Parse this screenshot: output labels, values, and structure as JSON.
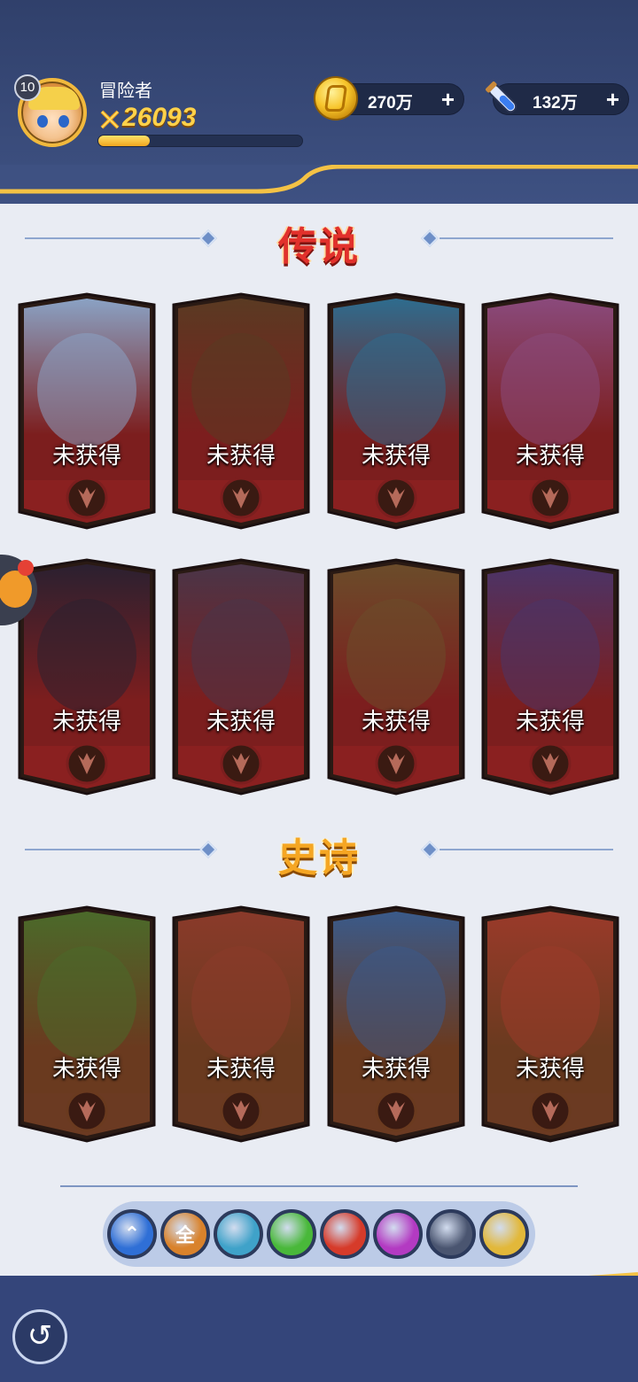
{
  "player": {
    "level": "10",
    "name": "冒险者",
    "power": "26093",
    "xp_progress": 0.25
  },
  "resources": {
    "gold": "270万",
    "potion": "132万",
    "plus_label": "+"
  },
  "sections": {
    "legend_title": "传说",
    "epic_title": "史诗"
  },
  "cards": {
    "locked_label": "未获得",
    "legend": [
      {
        "id": "white-yeti",
        "art_color": "#8aa2c4"
      },
      {
        "id": "beast-warrior",
        "art_color": "#5a3a22"
      },
      {
        "id": "blue-sorceress",
        "art_color": "#2e6c8e"
      },
      {
        "id": "octopus-pirate",
        "art_color": "#8a4a7c"
      },
      {
        "id": "shadow-knight",
        "art_color": "#2b2030"
      },
      {
        "id": "golden-archer",
        "art_color": "#4a3548"
      },
      {
        "id": "raccoon-sage",
        "art_color": "#6b4c2a"
      },
      {
        "id": "purple-priestess",
        "art_color": "#4b3468"
      }
    ],
    "epic": [
      {
        "id": "green-dragon",
        "art_color": "#4b6a2a"
      },
      {
        "id": "red-minotaur",
        "art_color": "#8a3a2a"
      },
      {
        "id": "blue-griffin",
        "art_color": "#3a5a8a"
      },
      {
        "id": "red-lion",
        "art_color": "#9a3a2a"
      }
    ]
  },
  "filters": [
    {
      "name": "collapse",
      "label": "⌃",
      "color": "#2f6fd6"
    },
    {
      "name": "all",
      "label": "全",
      "color": "#d9822b"
    },
    {
      "name": "helm-faction",
      "label": "",
      "color": "#3fa2c9"
    },
    {
      "name": "nature-faction",
      "label": "",
      "color": "#49b83a"
    },
    {
      "name": "fire-faction",
      "label": "",
      "color": "#d63b2a"
    },
    {
      "name": "arcane-faction",
      "label": "",
      "color": "#b33ac2"
    },
    {
      "name": "dark-faction",
      "label": "",
      "color": "#4a5570"
    },
    {
      "name": "light-faction",
      "label": "",
      "color": "#e2b83a"
    }
  ],
  "colors": {
    "legend_card_frame": "#7c1e1e",
    "epic_card_frame": "#6a3a1f"
  }
}
